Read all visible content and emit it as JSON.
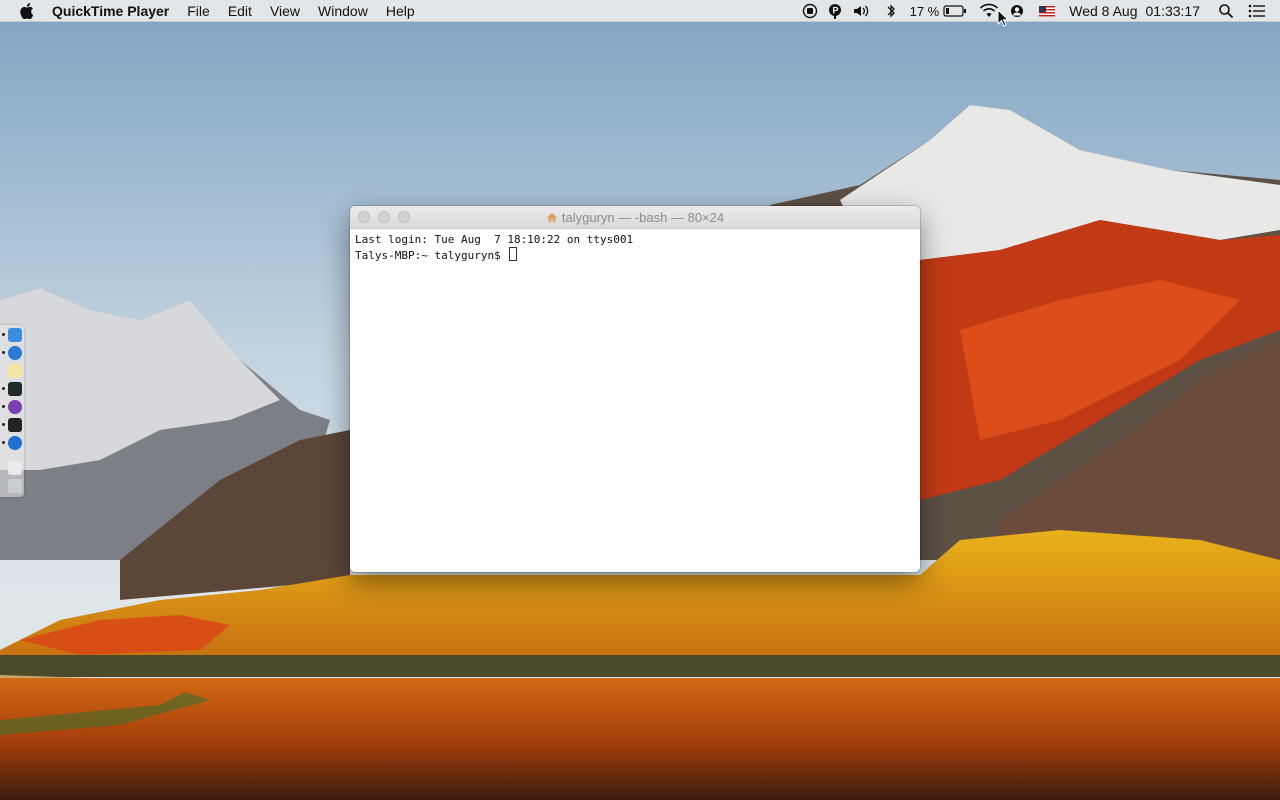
{
  "menubar": {
    "app_name": "QuickTime Player",
    "menus": [
      "File",
      "Edit",
      "View",
      "Window",
      "Help"
    ],
    "battery_percent": "17 %",
    "clock_day": "Wed 8 Aug",
    "clock_time": "01:33:17",
    "icons": [
      "record-icon",
      "p-icon",
      "volume-icon",
      "bluetooth-icon",
      "battery-icon",
      "wifi-icon",
      "user-icon",
      "flag-icon",
      "spotlight-icon",
      "notification-icon"
    ]
  },
  "terminal": {
    "title": "talyguryn — -bash — 80×24",
    "lines": [
      "Last login: Tue Aug  7 18:10:22 on ttys001",
      "Talys-MBP:~ talyguryn$ "
    ]
  },
  "dock": {
    "icons": [
      "finder-icon",
      "safari-icon",
      "notes-icon",
      "activity-icon",
      "github-icon",
      "terminal-icon",
      "browser-icon",
      "folder-icon",
      "trash-icon"
    ]
  }
}
